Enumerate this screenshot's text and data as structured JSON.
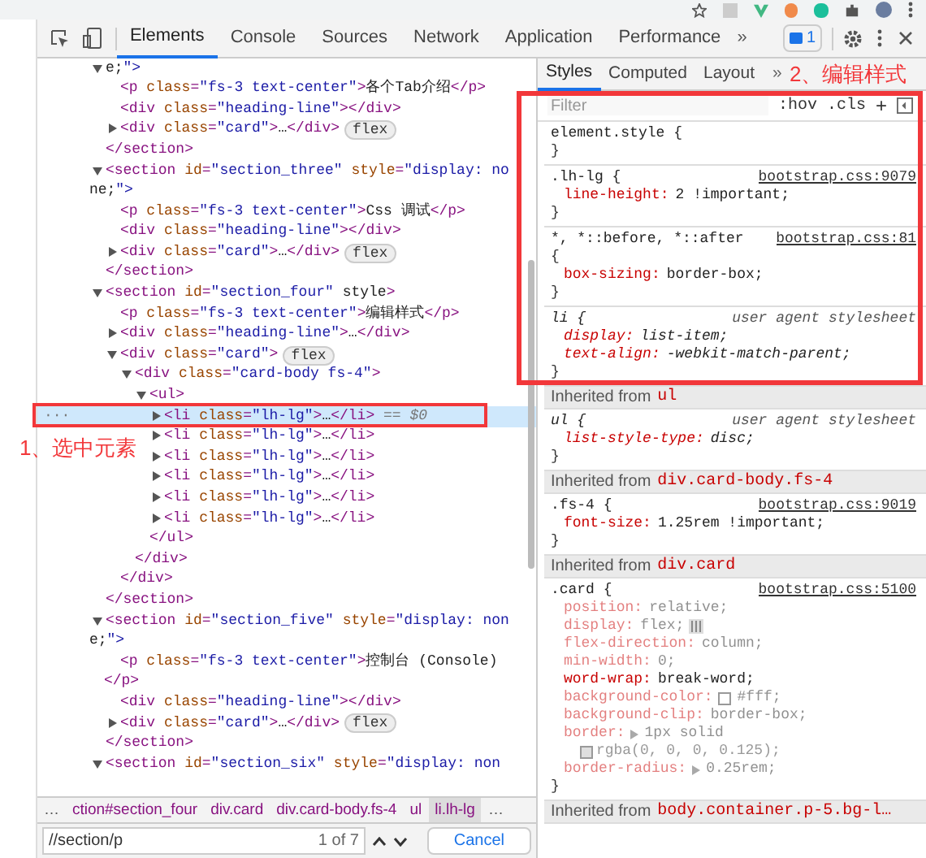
{
  "toolbar": {
    "tabs": [
      {
        "label": "Elements",
        "selected": true
      },
      {
        "label": "Console",
        "selected": false
      },
      {
        "label": "Sources",
        "selected": false
      },
      {
        "label": "Network",
        "selected": false
      },
      {
        "label": "Application",
        "selected": false
      },
      {
        "label": "Performance",
        "selected": false
      }
    ],
    "more": "»",
    "issues_count": "1"
  },
  "dom_tree": [
    {
      "open": [
        "e;\">"
      ],
      "expanded": true,
      "children": [
        {
          "open": [
            "<p class=\"fs-3 text-center\">各个Tab介绍</p>"
          ]
        },
        {
          "open": [
            "<div class=\"heading-line\"></div>"
          ]
        },
        {
          "open": [
            "<div class=\"card\">…</div>"
          ],
          "expanded": false,
          "badge": "flex"
        }
      ],
      "close": "</section>"
    },
    {
      "open": [
        "<section id=\"section_three\" style=\"display: no",
        "ne;\">"
      ],
      "expanded": true,
      "children": [
        {
          "open": [
            "<p class=\"fs-3 text-center\">Css 调试</p>"
          ]
        },
        {
          "open": [
            "<div class=\"heading-line\"></div>"
          ]
        },
        {
          "open": [
            "<div class=\"card\">…</div>"
          ],
          "expanded": false,
          "badge": "flex"
        }
      ],
      "close": "</section>"
    },
    {
      "open": [
        "<section id=\"section_four\" style>"
      ],
      "expanded": true,
      "children": [
        {
          "open": [
            "<p class=\"fs-3 text-center\">编辑样式</p>"
          ]
        },
        {
          "open": [
            "<div class=\"heading-line\">…</div>"
          ],
          "expanded": false
        },
        {
          "open": [
            "<div class=\"card\">"
          ],
          "expanded": true,
          "badge": "flex",
          "children": [
            {
              "open": [
                "<div class=\"card-body fs-4\">"
              ],
              "expanded": true,
              "children": [
                {
                  "open": [
                    "<ul>"
                  ],
                  "expanded": true,
                  "children": [
                    {
                      "open": [
                        "<li class=\"lh-lg\">…</li>"
                      ],
                      "expanded": false,
                      "selected": true,
                      "suffix": " == $0",
                      "gutter": "···"
                    },
                    {
                      "open": [
                        "<li class=\"lh-lg\">…</li>"
                      ],
                      "expanded": false,
                      "selected": false
                    },
                    {
                      "open": [
                        "<li class=\"lh-lg\">…</li>"
                      ],
                      "expanded": false,
                      "selected": false
                    },
                    {
                      "open": [
                        "<li class=\"lh-lg\">…</li>"
                      ],
                      "expanded": false,
                      "selected": false
                    },
                    {
                      "open": [
                        "<li class=\"lh-lg\">…</li>"
                      ],
                      "expanded": false,
                      "selected": false
                    },
                    {
                      "open": [
                        "<li class=\"lh-lg\">…</li>"
                      ],
                      "expanded": false,
                      "selected": false
                    }
                  ],
                  "close": "</ul>"
                }
              ],
              "close": "</div>"
            }
          ],
          "close": "</div>"
        }
      ],
      "close": "</section>"
    },
    {
      "open": [
        "<section id=\"section_five\" style=\"display: non",
        "e;\">"
      ],
      "expanded": true,
      "children": [
        {
          "open": [
            "<p class=\"fs-3 text-center\">控制台 (Console)",
            "</p>"
          ]
        },
        {
          "open": [
            "<div class=\"heading-line\"></div>"
          ]
        },
        {
          "open": [
            "<div class=\"card\">…</div>"
          ],
          "expanded": false,
          "badge": "flex"
        }
      ],
      "close": "</section>"
    },
    {
      "open": [
        "<section id=\"section_six\" style=\"display: non"
      ],
      "expanded": true
    }
  ],
  "breadcrumbs": [
    {
      "label": "…",
      "selected": false
    },
    {
      "label": "ction#section_four",
      "selected": false
    },
    {
      "label": "div.card",
      "selected": false
    },
    {
      "label": "div.card-body.fs-4",
      "selected": false
    },
    {
      "label": "ul",
      "selected": false
    },
    {
      "label": "li.lh-lg",
      "selected": true
    },
    {
      "label": "…",
      "selected": false
    }
  ],
  "search": {
    "value": "//section/p",
    "count": "1 of 7",
    "cancel": "Cancel"
  },
  "styles": {
    "tabs": [
      {
        "label": "Styles",
        "selected": true
      },
      {
        "label": "Computed",
        "selected": false
      },
      {
        "label": "Layout",
        "selected": false
      }
    ],
    "more": "»",
    "filter": {
      "placeholder": "Filter",
      "hov": ":hov",
      "cls": ".cls",
      "plus": "+"
    },
    "blocks": [
      {
        "kind": "rule",
        "selector": "element.style {",
        "close": "}"
      },
      {
        "kind": "rule",
        "selector": ".lh-lg {",
        "source": "bootstrap.css:9079",
        "close": "}",
        "decls": [
          {
            "prop": "line-height:",
            "value": "2 !important;",
            "active": true
          }
        ]
      },
      {
        "kind": "rule",
        "selector": "*, *::before, *::after",
        "source": "bootstrap.css:81",
        "open_brace": "{",
        "close": "}",
        "decls": [
          {
            "prop": "box-sizing:",
            "value": "border-box;",
            "active": true
          }
        ]
      },
      {
        "kind": "rule",
        "selector": "li {",
        "origin": "user agent stylesheet",
        "italic": true,
        "close": "}",
        "decls": [
          {
            "prop": "display:",
            "value": "list-item;",
            "active": true
          },
          {
            "prop": "text-align:",
            "value": "-webkit-match-parent;",
            "active": true
          }
        ]
      },
      {
        "kind": "inherited",
        "label": "Inherited from",
        "from": "ul"
      },
      {
        "kind": "rule",
        "selector": "ul {",
        "origin": "user agent stylesheet",
        "italic": true,
        "close": "}",
        "decls": [
          {
            "prop": "list-style-type:",
            "value": "disc;",
            "active": true
          }
        ]
      },
      {
        "kind": "inherited",
        "label": "Inherited from",
        "from": "div.card-body.fs-4"
      },
      {
        "kind": "rule",
        "selector": ".fs-4 {",
        "source": "bootstrap.css:9019",
        "close": "}",
        "decls": [
          {
            "prop": "font-size:",
            "value": "1.25rem !important;",
            "active": true
          }
        ]
      },
      {
        "kind": "inherited",
        "label": "Inherited from",
        "from": "div.card"
      },
      {
        "kind": "rule",
        "selector": ".card {",
        "source": "bootstrap.css:5100",
        "close": "}",
        "decls": [
          {
            "prop": "position:",
            "value": "relative;",
            "active": false
          },
          {
            "prop": "display:",
            "value": "flex;",
            "active": false,
            "flex_icon": true
          },
          {
            "prop": "flex-direction:",
            "value": "column;",
            "active": false
          },
          {
            "prop": "min-width:",
            "value": "0;",
            "active": false
          },
          {
            "prop": "word-wrap:",
            "value": "break-word;",
            "active": true
          },
          {
            "prop": "background-color:",
            "value": "#fff;",
            "active": false,
            "swatch": true
          },
          {
            "prop": "background-clip:",
            "value": "border-box;",
            "active": false
          },
          {
            "prop": "border:",
            "value": "1px solid",
            "active": false,
            "expandable": true,
            "continuation": {
              "value": "rgba(0, 0, 0, 0.125);",
              "swatch": true
            }
          },
          {
            "prop": "border-radius:",
            "value": "0.25rem;",
            "active": false,
            "expandable": true
          }
        ]
      },
      {
        "kind": "inherited",
        "label": "Inherited from",
        "from": "body.container.p-5.bg-l…"
      }
    ]
  },
  "annotations": [
    {
      "text": "1、选中元素"
    },
    {
      "text": "2、编辑样式"
    }
  ]
}
